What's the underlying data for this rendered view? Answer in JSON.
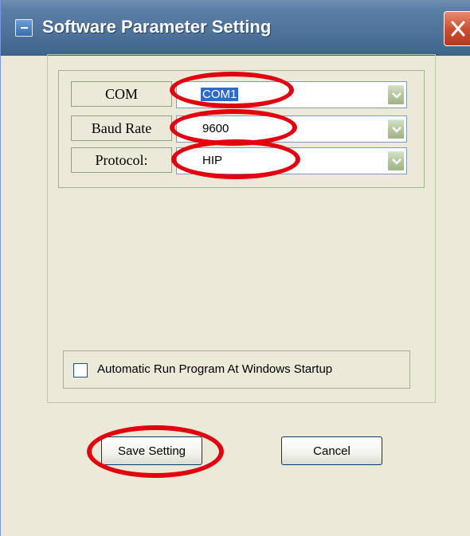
{
  "window": {
    "title": "Software Parameter Setting",
    "close_icon": "close-icon",
    "app_icon": "window-menu-icon"
  },
  "settings": {
    "rows": [
      {
        "label": "COM",
        "value": "COM1",
        "selected": true
      },
      {
        "label": "Baud Rate",
        "value": "9600",
        "selected": false
      },
      {
        "label": "Protocol:",
        "value": "HIP",
        "selected": false
      }
    ]
  },
  "options": {
    "autorun_label": "Automatic Run Program At Windows Startup",
    "autorun_checked": false
  },
  "buttons": {
    "save_label": "Save Setting",
    "cancel_label": "Cancel"
  },
  "colors": {
    "titlebar": "#4e729a",
    "annotation": "#e3000f",
    "selection": "#316ac5"
  }
}
